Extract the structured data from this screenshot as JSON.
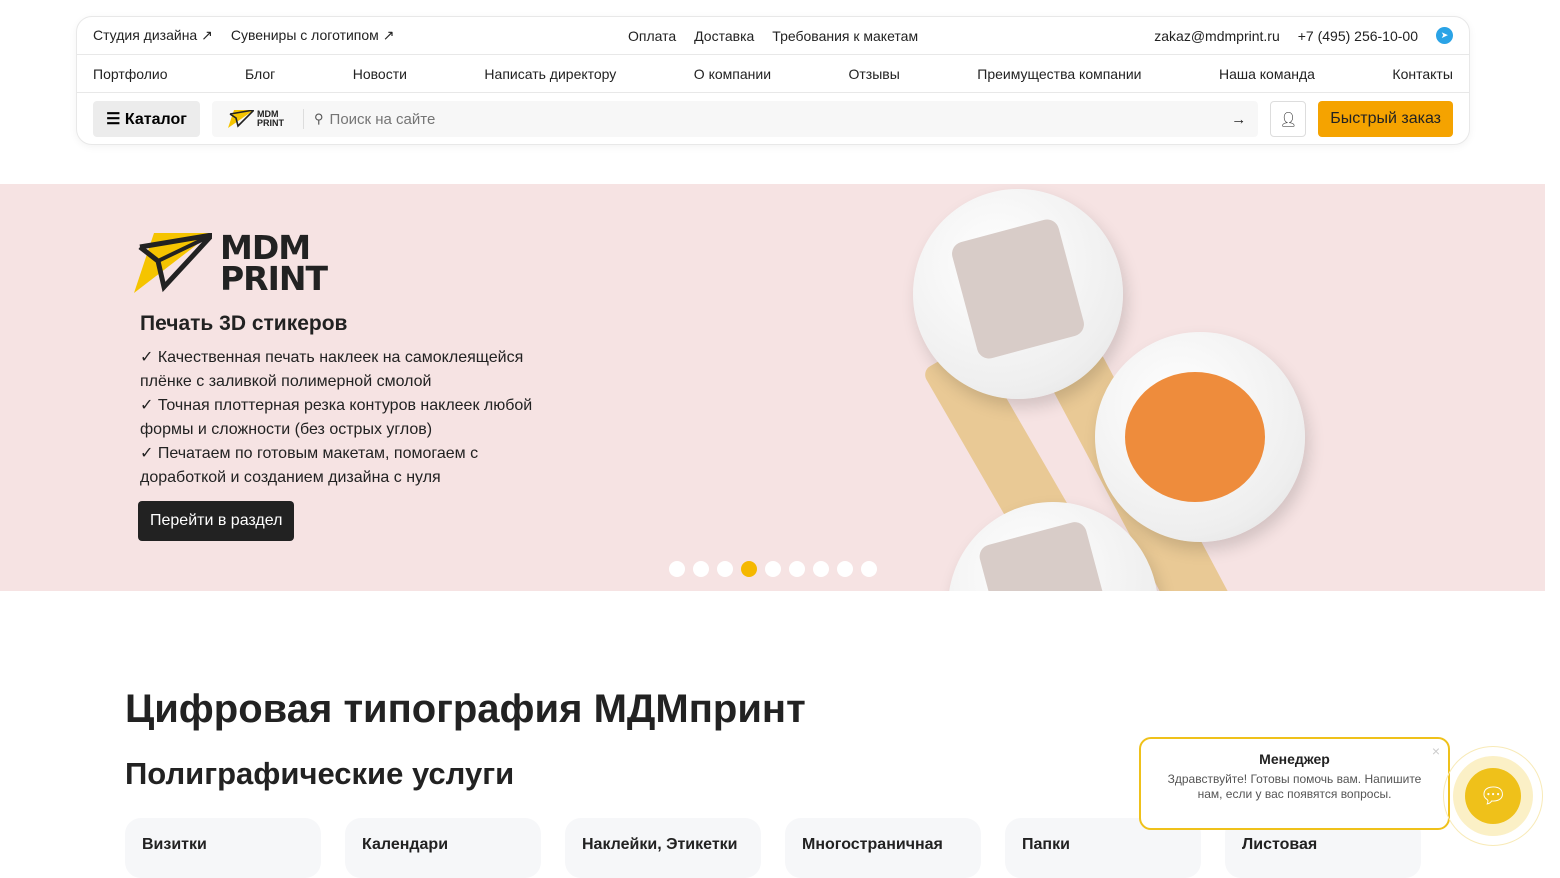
{
  "header": {
    "top_left": [
      {
        "label": "Студия дизайна ↗"
      },
      {
        "label": "Сувениры с логотипом ↗"
      }
    ],
    "top_center": [
      {
        "label": "Оплата"
      },
      {
        "label": "Доставка"
      },
      {
        "label": "Требования к макетам"
      }
    ],
    "email": "zakaz@mdmprint.ru",
    "phone": "+7 (495) 256-10-00",
    "nav": [
      {
        "label": "Портфолио"
      },
      {
        "label": "Блог"
      },
      {
        "label": "Новости"
      },
      {
        "label": "Написать директору"
      },
      {
        "label": "О компании"
      },
      {
        "label": "Отзывы"
      },
      {
        "label": "Преимущества компании"
      },
      {
        "label": "Наша команда"
      },
      {
        "label": "Контакты"
      }
    ],
    "catalog_label": "☰ Каталог",
    "logo_text": "MDM PRINT",
    "search_placeholder": "Поиск на сайте",
    "quick_order": "Быстрый заказ"
  },
  "hero": {
    "logo_line1": "MDM",
    "logo_line2": "PRINT",
    "title": "Печать 3D стикеров",
    "lines": [
      "✓ Качественная печать наклеек на самоклеящейся плёнке с заливкой полимерной смолой",
      "✓ Точная плоттерная резка контуров наклеек любой формы и сложности (без острых углов)",
      "✓ Печатаем по готовым макетам, помогаем с доработкой и созданием дизайна с нуля"
    ],
    "button": "Перейти в раздел",
    "slides_total": 9,
    "active_slide": 4
  },
  "main": {
    "title": "Цифровая типография МДМпринт",
    "subtitle": "Полиграфические услуги",
    "cards": [
      {
        "label": "Визитки"
      },
      {
        "label": "Календари"
      },
      {
        "label": "Наклейки, Этикетки"
      },
      {
        "label": "Многостраничная"
      },
      {
        "label": "Папки"
      },
      {
        "label": "Листовая"
      }
    ]
  },
  "chat": {
    "name": "Менеджер",
    "message": "Здравствуйте! Готовы помочь вам. Напишите нам, если у вас появятся вопросы.",
    "close": "×"
  }
}
